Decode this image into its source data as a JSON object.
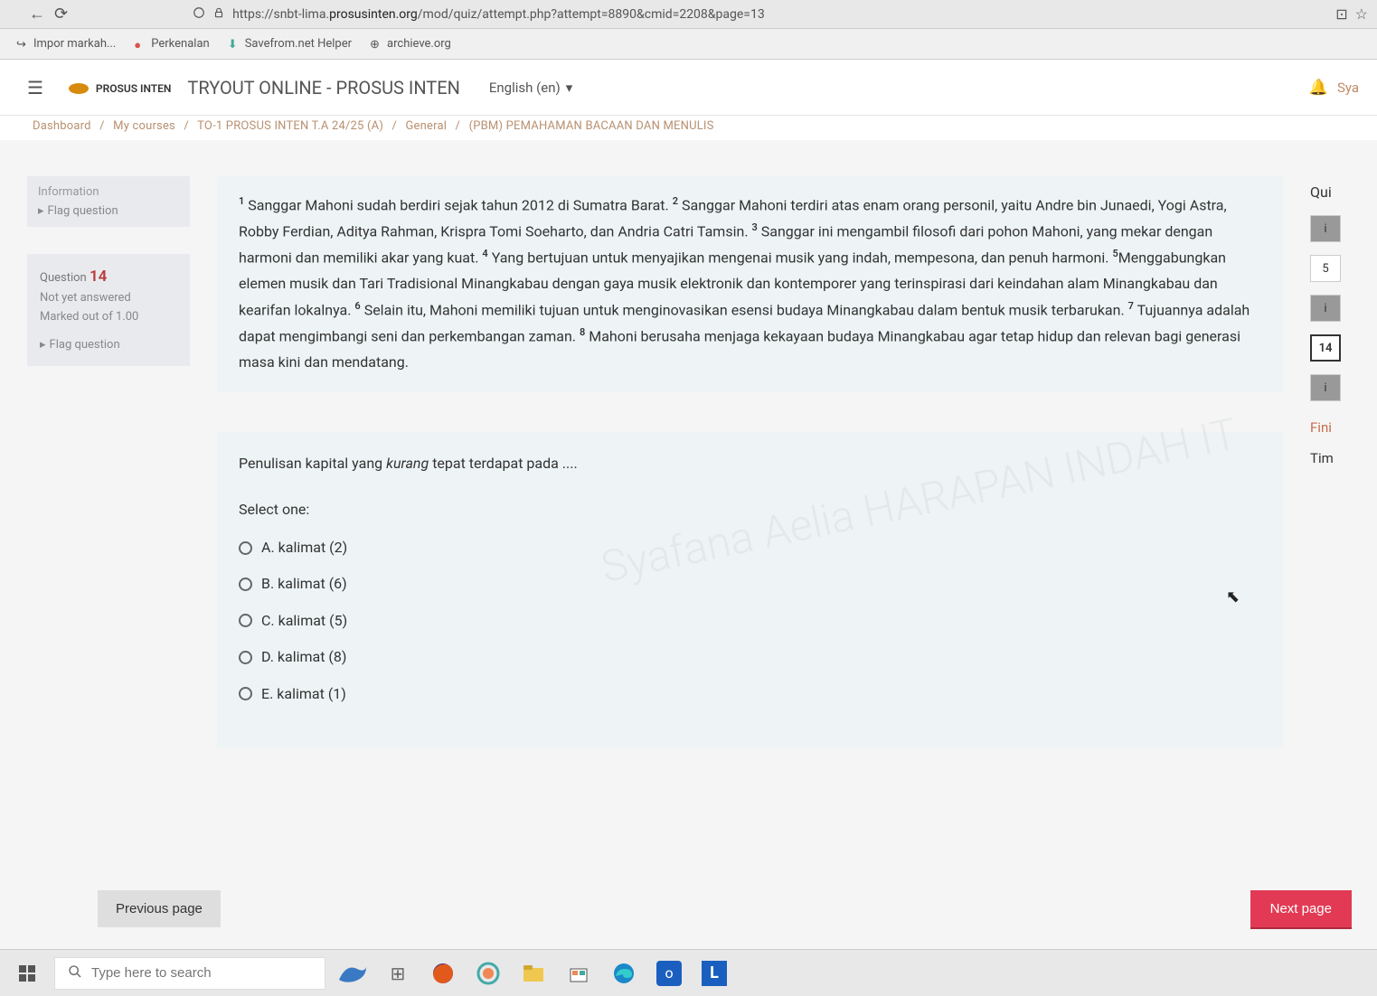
{
  "browser": {
    "url_pre": "https://snbt-lima.",
    "url_domain": "prosusinten.org",
    "url_post": "/mod/quiz/attempt.php?attempt=8890&cmid=2208&page=13"
  },
  "bookmarks": {
    "item1": "Impor markah...",
    "item2": "Perkenalan",
    "item3": "Savefrom.net Helper",
    "item4": "archieve.org"
  },
  "header": {
    "logo_text": "PROSUS INTEN",
    "site_title": "TRYOUT ONLINE - PROSUS INTEN",
    "lang": "English (en)",
    "user_short": "Sya"
  },
  "breadcrumb": {
    "c1": "Dashboard",
    "c2": "My courses",
    "c3": "TO-1 PROSUS INTEN T.A 24/25 (A)",
    "c4": "General",
    "c5": "(PBM) PEMAHAMAN BACAAN DAN MENULIS"
  },
  "info_box": {
    "title": "Information",
    "flag": "Flag question"
  },
  "passage": {
    "s1": "Sanggar Mahoni sudah berdiri sejak tahun 2012 di Sumatra Barat.",
    "s2": "Sanggar Mahoni terdiri atas enam orang personil, yaitu Andre bin Junaedi, Yogi Astra, Robby Ferdian, Aditya Rahman, Krispra Tomi Soeharto, dan Andria Catri Tamsin.",
    "s3": "Sanggar ini mengambil filosofi dari pohon Mahoni, yang mekar dengan harmoni dan memiliki akar yang kuat.",
    "s4": "Yang bertujuan untuk menyajikan mengenai musik yang indah, mempesona, dan penuh harmoni.",
    "s5": "Menggabungkan elemen musik dan Tari Tradisional Minangkabau dengan gaya musik elektronik dan kontemporer yang terinspirasi dari keindahan alam Minangkabau dan kearifan lokalnya.",
    "s6": "Selain itu, Mahoni memiliki tujuan untuk menginovasikan esensi budaya Minangkabau dalam bentuk musik terbarukan.",
    "s7": "Tujuannya adalah dapat mengimbangi seni dan perkembangan zaman.",
    "s8": "Mahoni berusaha menjaga kekayaan budaya Minangkabau agar tetap hidup dan relevan bagi generasi masa kini dan mendatang."
  },
  "question_meta": {
    "label": "Question",
    "number": "14",
    "status": "Not yet answered",
    "marked": "Marked out of 1.00",
    "flag": "Flag question"
  },
  "question": {
    "prompt_pre": "Penulisan kapital yang ",
    "prompt_em": "kurang",
    "prompt_post": " tepat terdapat pada ....",
    "select": "Select one:",
    "options": {
      "a": "A. kalimat (2)",
      "b": "B. kalimat (6)",
      "c": "C. kalimat (5)",
      "d": "D. kalimat (8)",
      "e": "E. kalimat (1)"
    },
    "watermark": "Syafana Aelia HARAPAN INDAH IT"
  },
  "right_nav": {
    "head": "Qui",
    "i1": "i",
    "n5": "5",
    "i2": "i",
    "n14": "14",
    "i3": "i",
    "finish": "Fini",
    "time": "Tim"
  },
  "nav": {
    "prev": "Previous page",
    "next": "Next page"
  },
  "taskbar": {
    "search_placeholder": "Type here to search"
  }
}
